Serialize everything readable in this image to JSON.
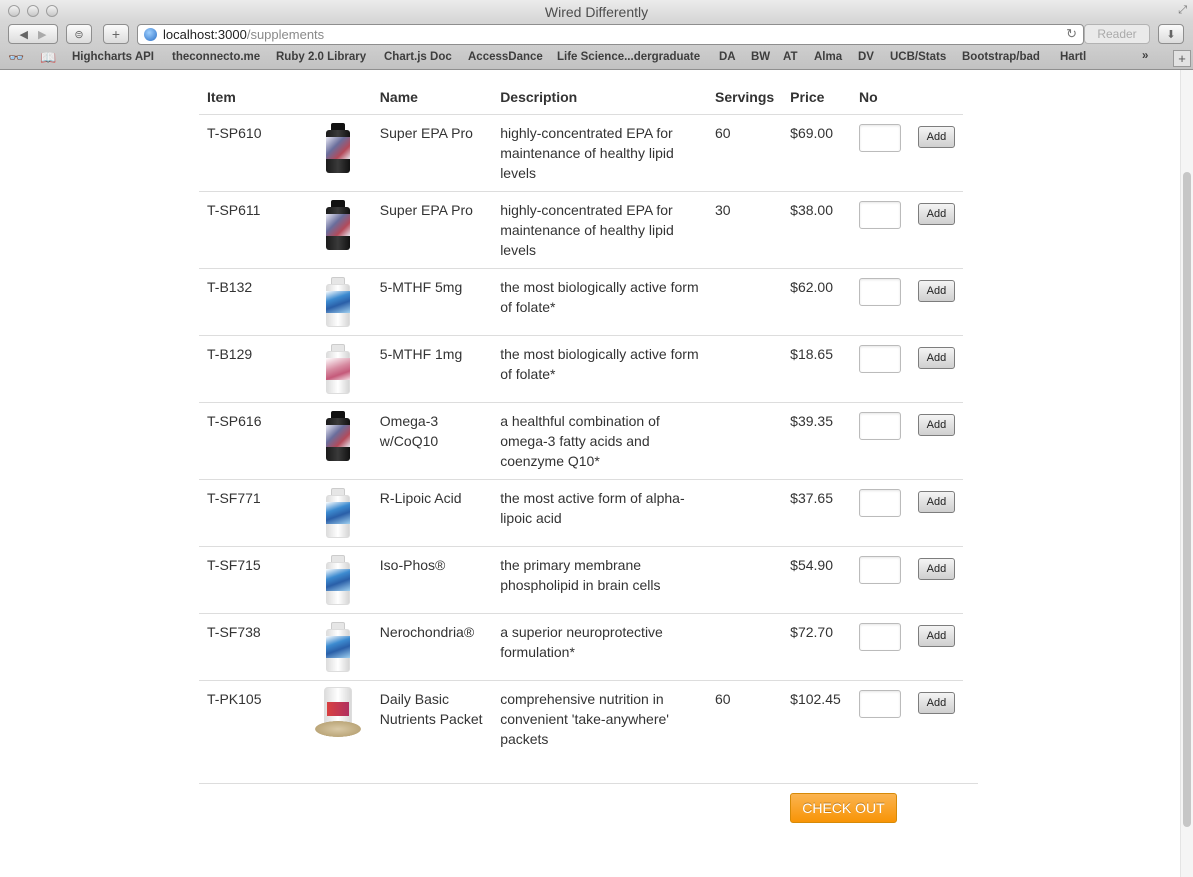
{
  "window": {
    "title": "Wired Differently"
  },
  "toolbar": {
    "url_host": "localhost:3000",
    "url_path": "/supplements",
    "reader_label": "Reader"
  },
  "bookmarks": [
    "Highcharts API",
    "theconnecto.me",
    "Ruby 2.0 Library",
    "Chart.js Doc",
    "AccessDance",
    "Life Science...dergraduate",
    "DA",
    "BW",
    "AT",
    "Alma",
    "DV",
    "UCB/Stats",
    "Bootstrap/bad",
    "Hartl"
  ],
  "table": {
    "headers": {
      "item": "Item",
      "image": "",
      "name": "Name",
      "description": "Description",
      "servings": "Servings",
      "price": "Price",
      "no": "No"
    },
    "add_label": "Add",
    "rows": [
      {
        "item": "T-SP610",
        "bottle": "dark",
        "name": "Super EPA Pro",
        "description": "highly-concentrated EPA for maintenance of healthy lipid levels",
        "servings": "60",
        "price": "$69.00"
      },
      {
        "item": "T-SP611",
        "bottle": "dark",
        "name": "Super EPA Pro",
        "description": "highly-concentrated EPA for maintenance of healthy lipid levels",
        "servings": "30",
        "price": "$38.00"
      },
      {
        "item": "T-B132",
        "bottle": "white",
        "name": "5-MTHF 5mg",
        "description": "the most biologically active form of folate*",
        "servings": "",
        "price": "$62.00"
      },
      {
        "item": "T-B129",
        "bottle": "pink",
        "name": "5-MTHF 1mg",
        "description": "the most biologically active form of folate*",
        "servings": "",
        "price": "$18.65"
      },
      {
        "item": "T-SP616",
        "bottle": "dark",
        "name": "Omega-3 w/CoQ10",
        "description": "a healthful combination of omega-3 fatty acids and coenzyme Q10*",
        "servings": "",
        "price": "$39.35"
      },
      {
        "item": "T-SF771",
        "bottle": "white",
        "name": "R-Lipoic Acid",
        "description": "the most active form of alpha-lipoic acid",
        "servings": "",
        "price": "$37.65"
      },
      {
        "item": "T-SF715",
        "bottle": "white",
        "name": "Iso-Phos®",
        "description": "the primary membrane phospholipid in brain cells",
        "servings": "",
        "price": "$54.90"
      },
      {
        "item": "T-SF738",
        "bottle": "white",
        "name": "Nerochondria®",
        "description": "a superior neuroprotective formulation*",
        "servings": "",
        "price": "$72.70"
      },
      {
        "item": "T-PK105",
        "bottle": "packet",
        "name": "Daily Basic Nutrients Packet",
        "description": "comprehensive nutrition in convenient 'take-anywhere' packets",
        "servings": "60",
        "price": "$102.45"
      }
    ]
  },
  "checkout_label": "CHECK OUT"
}
